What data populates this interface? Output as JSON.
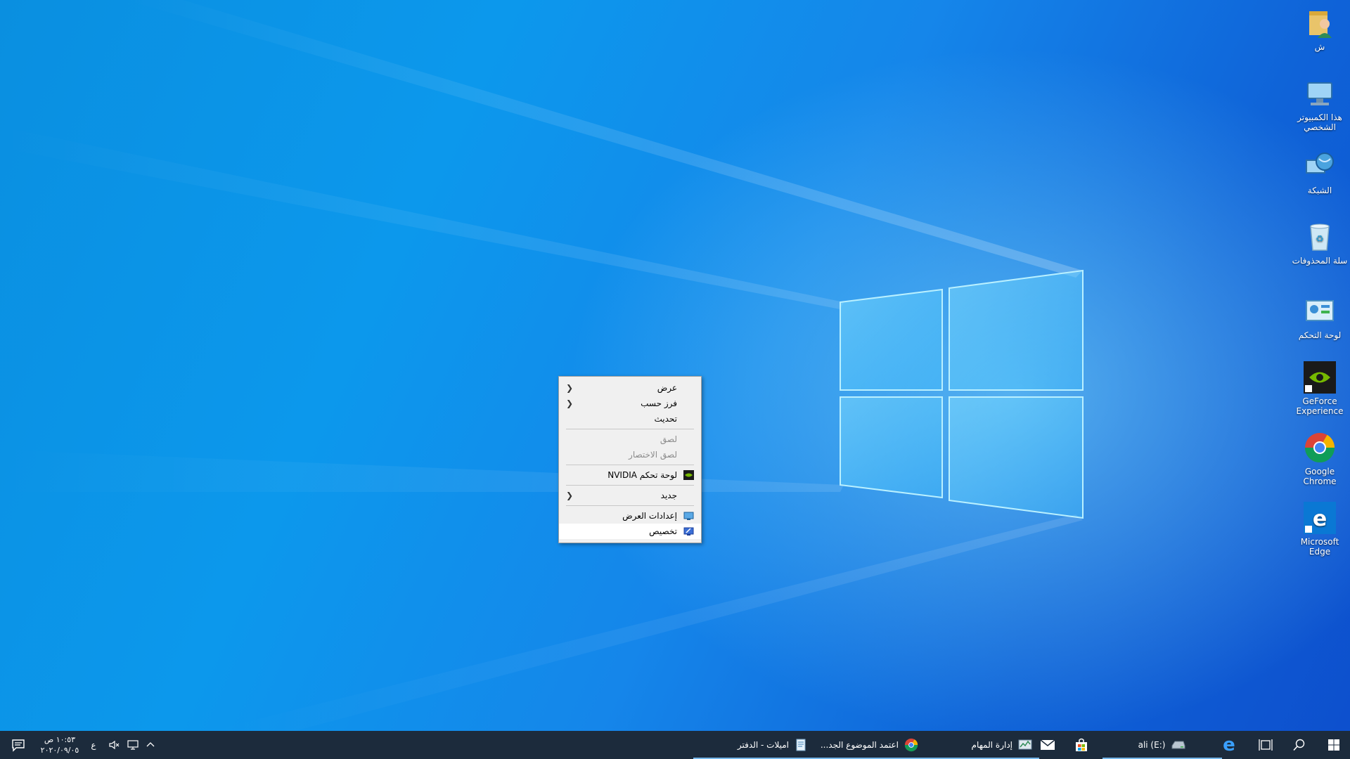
{
  "desktop_icons": [
    {
      "label": "ش",
      "icon": "user-folder-icon"
    },
    {
      "label": "هذا الكمبيوتر الشخصي",
      "icon": "this-pc-icon"
    },
    {
      "label": "الشبكة",
      "icon": "network-icon"
    },
    {
      "label": "سلة المحذوفات",
      "icon": "recycle-bin-icon"
    },
    {
      "label": "لوحة التحكم",
      "icon": "control-panel-icon"
    },
    {
      "label": "GeForce Experience",
      "icon": "geforce-experience-icon"
    },
    {
      "label": "Google Chrome",
      "icon": "chrome-icon"
    },
    {
      "label": "Microsoft Edge",
      "icon": "edge-icon"
    }
  ],
  "context_menu": {
    "view": "عرض",
    "sort_by": "فرز حسب",
    "refresh": "تحديث",
    "paste": "لصق",
    "paste_shortcut": "لصق الاختصار",
    "nvidia": "لوحة تحكم NVIDIA",
    "new": "جديد",
    "display_settings": "إعدادات العرض",
    "personalize": "تخصيص"
  },
  "taskbar": {
    "notes_app": "اميلات - الدفتر",
    "chrome_app": "اعتمد الموضوع الجد...",
    "task_manager_app": "إدارة المهام",
    "drive": "ali (E:)",
    "language": "ع",
    "time": "١٠:٥٣ ص",
    "date": "٢٠٢٠/٠٩/٠٥"
  },
  "colors": {
    "accent": "#76b9ed",
    "taskbar": "#1c2b3c",
    "menu": "#f0f0f0"
  }
}
